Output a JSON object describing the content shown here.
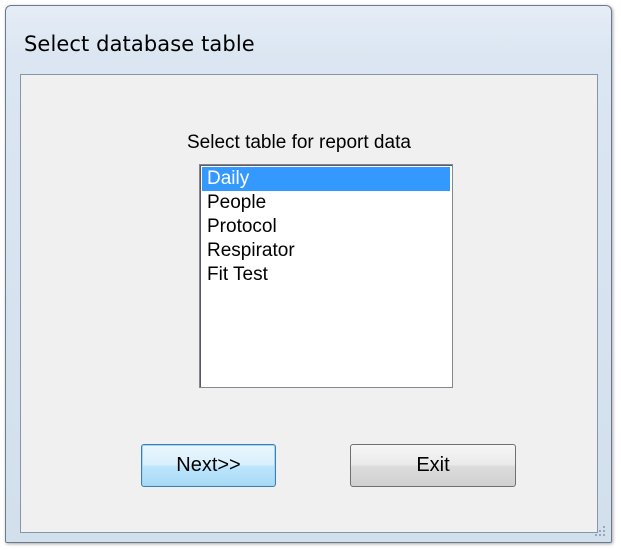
{
  "window": {
    "title": "Select database table"
  },
  "dialog": {
    "prompt": "Select table for report data",
    "selected_table": "Daily",
    "tables": [
      "Daily",
      "People",
      "Protocol",
      "Respirator",
      "Fit Test"
    ],
    "next_label": "Next>>",
    "exit_label": "Exit"
  },
  "colors": {
    "selection": "#3399ff",
    "default_button_border": "#3c7fb1"
  }
}
